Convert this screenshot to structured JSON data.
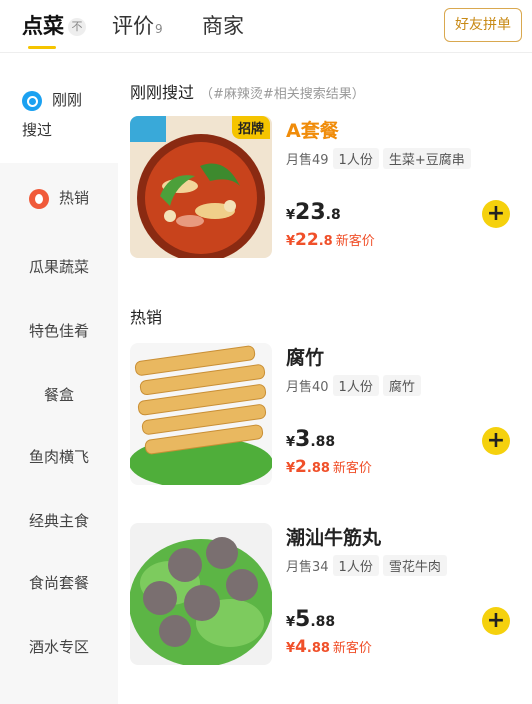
{
  "tabs": {
    "order": "点菜",
    "order_badge": "不",
    "reviews": "评价",
    "reviews_count": "9",
    "merchant": "商家",
    "share_button": "好友拼单"
  },
  "sidebar": {
    "items": [
      {
        "line1": "刚刚",
        "line2": "搜过",
        "icon": "search-history-icon"
      },
      {
        "label": "热销",
        "icon": "hot-icon"
      },
      {
        "label": "瓜果蔬菜"
      },
      {
        "label": "特色佳肴"
      },
      {
        "label": "餐盒"
      },
      {
        "label": "鱼肉横飞"
      },
      {
        "label": "经典主食"
      },
      {
        "label": "食尚套餐"
      },
      {
        "label": "酒水专区"
      }
    ]
  },
  "sections": {
    "recent_title": "刚刚搜过",
    "recent_sub": "（#麻辣烫#相关搜索结果）",
    "hot_title": "热销"
  },
  "dishes": [
    {
      "name": "A套餐",
      "tag": "招牌",
      "sales": "月售49",
      "portion": "1人份",
      "ingredient": "生菜+豆腐串",
      "price_yen": "¥",
      "price_int": "23",
      "price_dec": ".8",
      "new_yen": "¥",
      "new_int": "22",
      "new_dec": ".8",
      "new_label": "新客价"
    },
    {
      "name": "腐竹",
      "sales": "月售40",
      "portion": "1人份",
      "ingredient": "腐竹",
      "price_yen": "¥",
      "price_int": "3",
      "price_dec": ".88",
      "new_yen": "¥",
      "new_int": "2",
      "new_dec": ".88",
      "new_label": "新客价"
    },
    {
      "name": "潮汕牛筋丸",
      "sales": "月售34",
      "portion": "1人份",
      "ingredient": "雪花牛肉",
      "price_yen": "¥",
      "price_int": "5",
      "price_dec": ".88",
      "new_yen": "¥",
      "new_int": "4",
      "new_dec": ".88",
      "new_label": "新客价"
    }
  ],
  "colors": {
    "accent": "#f5c400",
    "new_price": "#f0502a",
    "add_button": "#f5d10d"
  }
}
